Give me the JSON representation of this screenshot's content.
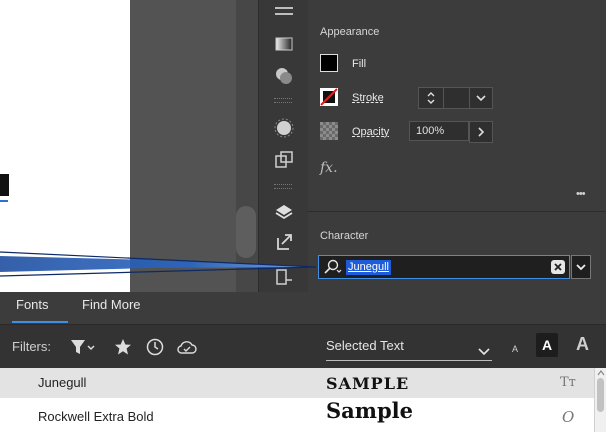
{
  "properties": {
    "appearance_title": "Appearance",
    "fill_label": "Fill",
    "stroke_label": "Stroke",
    "opacity_label": "Opacity",
    "opacity_value": "100%",
    "fx_label": "fx.",
    "more_label": "•••",
    "fill_color": "#000000",
    "accent_color": "#3f8fe6"
  },
  "character": {
    "title": "Character",
    "font_input_value": "Junegull"
  },
  "font_panel": {
    "tabs": [
      {
        "label": "Fonts",
        "active": true
      },
      {
        "label": "Find More",
        "active": false
      }
    ],
    "filters_label": "Filters:",
    "selected_text_label": "Selected Text",
    "size_small": "A",
    "size_medium": "A",
    "size_large": "A",
    "fonts": [
      {
        "name": "Junegull",
        "sample": "SAMPLE",
        "type_icon": "truetype-icon",
        "type_glyph": "Tт"
      },
      {
        "name": "Rockwell Extra Bold",
        "sample": "Sample",
        "type_icon": "opentype-icon",
        "type_glyph": "O"
      }
    ]
  }
}
